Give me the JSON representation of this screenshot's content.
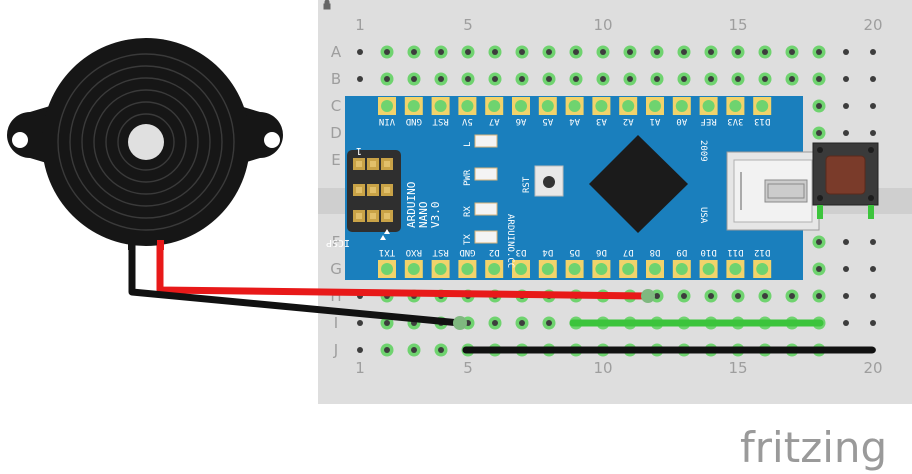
{
  "breadboard": {
    "columns": [
      "1",
      "2",
      "3",
      "4",
      "5",
      "6",
      "7",
      "8",
      "9",
      "10",
      "11",
      "12",
      "13",
      "14",
      "15",
      "16",
      "17",
      "18",
      "19",
      "20"
    ],
    "column_markers": [
      "1",
      "5",
      "10",
      "15",
      "20"
    ],
    "rows_top": [
      "A",
      "B",
      "C",
      "D",
      "E"
    ],
    "rows_bottom": [
      "F",
      "G",
      "H",
      "I",
      "J"
    ],
    "hole_color": "#3d3d3d",
    "connected_hole_color": "#6fd36f",
    "board_color": "#dedede",
    "label_color": "#9e9e9e"
  },
  "arduino": {
    "board_color": "#1a7fbd",
    "name_lines": [
      "ARDUINO",
      "NANO",
      "V3.0"
    ],
    "header_number": "1",
    "icsp_label": "ICSP",
    "top_pins": [
      "VIN",
      "GND",
      "RST",
      "5V",
      "A7",
      "A6",
      "A5",
      "A4",
      "A3",
      "A2",
      "A1",
      "A0",
      "REF",
      "3V3",
      "D13"
    ],
    "bottom_pins": [
      "TX1",
      "RXO",
      "RST",
      "GND",
      "D2",
      "D3",
      "D4",
      "D5",
      "D6",
      "D7",
      "D8",
      "D9",
      "D10",
      "D11",
      "D12"
    ],
    "led_labels": [
      "L",
      "PWR",
      "RX",
      "TX"
    ],
    "reset_label": "RST",
    "website": "ARDUINO.CC",
    "year": "2009",
    "country": "USA"
  },
  "wires": [
    {
      "color": "#e81919"
    },
    {
      "color": "#111111"
    },
    {
      "color": "#3cc43c"
    },
    {
      "color": "#111111"
    }
  ],
  "watermark": "fritzing"
}
